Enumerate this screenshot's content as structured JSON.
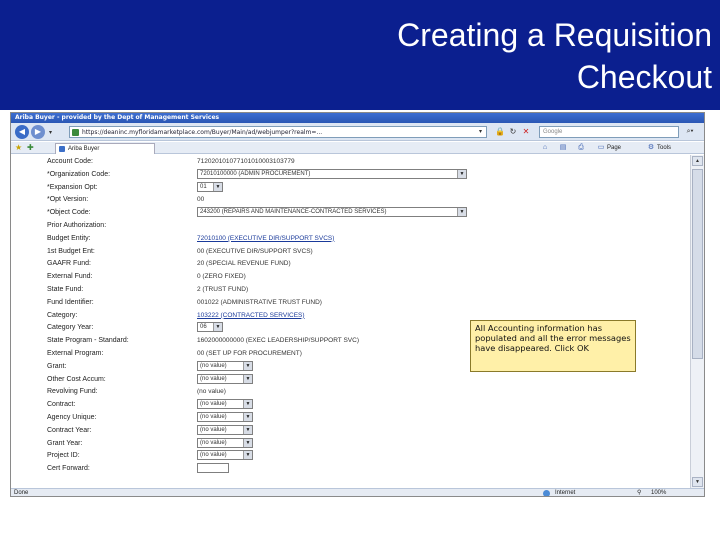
{
  "slide": {
    "title_line1": "Creating a Requisition",
    "title_line2": "Checkout"
  },
  "browser": {
    "window_title": "Ariba Buyer - provided by the Dept of Management Services",
    "address": "https://deaninc.myfloridamarketplace.com/Buyer/Main/ad/webjumper?realm=...",
    "search_placeholder": "Google",
    "tab_label": "Ariba Buyer",
    "commands": {
      "page": "Page",
      "tools": "Tools"
    },
    "status": {
      "left": "Done",
      "zone": "Internet",
      "zoom": "100%"
    }
  },
  "form": {
    "rows": [
      {
        "label": "Account Code:",
        "value": "712020101077101010003103779",
        "type": "text"
      },
      {
        "label": "*Organization Code:",
        "value": "72010100000 (ADMIN PROCUREMENT)",
        "type": "select"
      },
      {
        "label": "*Expansion Opt:",
        "value": "01",
        "type": "select"
      },
      {
        "label": "*Opt Version:",
        "value": "00",
        "type": "text"
      },
      {
        "label": "*Object Code:",
        "value": "243200 (REPAIRS AND MAINTENANCE-CONTRACTED SERVICES)",
        "type": "select"
      },
      {
        "label": "Prior Authorization:",
        "value": "",
        "type": "text"
      },
      {
        "label": "Budget Entity:",
        "value": "72010100 (EXECUTIVE DIR/SUPPORT SVCS)",
        "type": "link"
      },
      {
        "label": "1st Budget Ent:",
        "value": "00 (EXECUTIVE DIR/SUPPORT SVCS)",
        "type": "text"
      },
      {
        "label": "GAAFR Fund:",
        "value": "20 (SPECIAL REVENUE FUND)",
        "type": "text"
      },
      {
        "label": "External Fund:",
        "value": "0 (ZERO FIXED)",
        "type": "text"
      },
      {
        "label": "State Fund:",
        "value": "2 (TRUST FUND)",
        "type": "text"
      },
      {
        "label": "Fund Identifier:",
        "value": "001022 (ADMINISTRATIVE TRUST FUND)",
        "type": "text"
      },
      {
        "label": "Category:",
        "value": "103222 (CONTRACTED SERVICES)",
        "type": "link"
      },
      {
        "label": "Category Year:",
        "value": "06",
        "type": "select"
      },
      {
        "label": "State Program - Standard:",
        "value": "1602000000000 (EXEC LEADERSHIP/SUPPORT SVC)",
        "type": "text"
      },
      {
        "label": "External Program:",
        "value": "00 (SET UP FOR PROCUREMENT)",
        "type": "text"
      },
      {
        "label": "Grant:",
        "value": "(no value)",
        "type": "select"
      },
      {
        "label": "Other Cost Accum:",
        "value": "(no value)",
        "type": "select"
      },
      {
        "label": "Revolving Fund:",
        "value": "(no value)",
        "type": "text"
      },
      {
        "label": "Contract:",
        "value": "(no value)",
        "type": "select"
      },
      {
        "label": "Agency Unique:",
        "value": "(no value)",
        "type": "select"
      },
      {
        "label": "Contract Year:",
        "value": "(no value)",
        "type": "select"
      },
      {
        "label": "Grant Year:",
        "value": "(no value)",
        "type": "select"
      },
      {
        "label": "Project ID:",
        "value": "(no value)",
        "type": "select"
      },
      {
        "label": "Cert Forward:",
        "value": "",
        "type": "input"
      }
    ]
  },
  "callout": {
    "text": "All Accounting information has populated and all the error messages have disappeared. Click OK"
  },
  "colors": {
    "slide_header": "#0b1f8f",
    "callout_bg": "#fff0a8"
  }
}
